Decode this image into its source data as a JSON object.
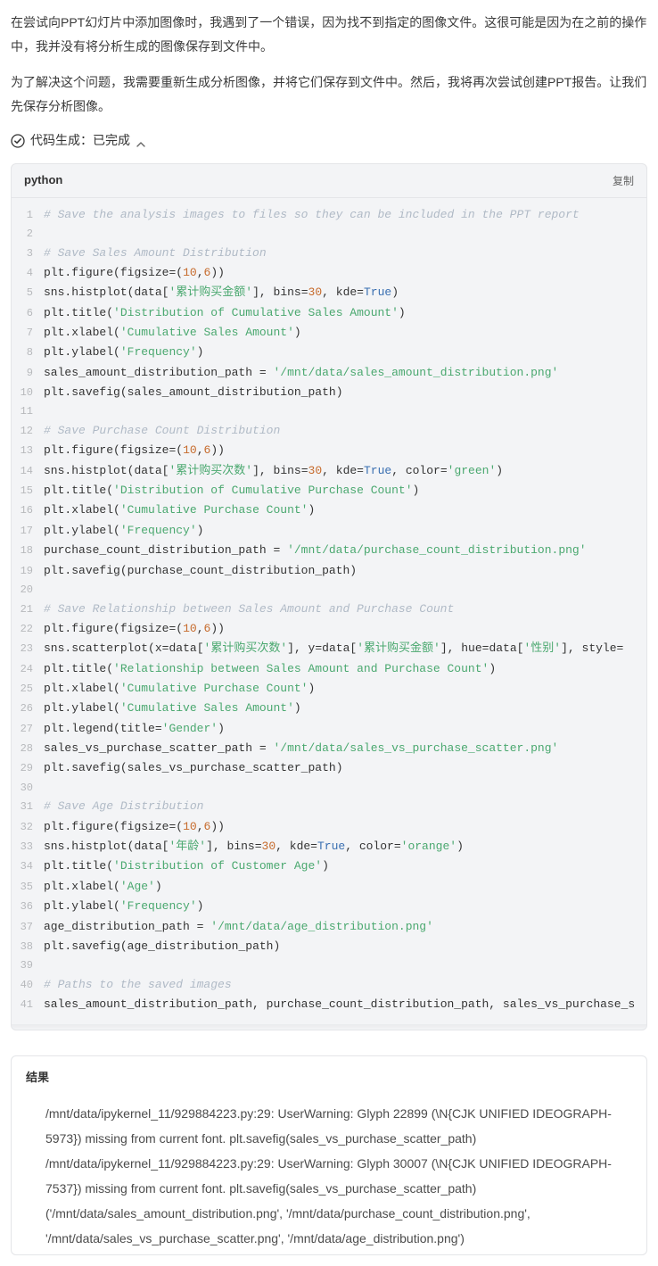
{
  "intro": {
    "p1": "在尝试向PPT幻灯片中添加图像时，我遇到了一个错误，因为找不到指定的图像文件。这很可能是因为在之前的操作中，我并没有将分析生成的图像保存到文件中。",
    "p2": "为了解决这个问题，我需要重新生成分析图像，并将它们保存到文件中。然后，我将再次尝试创建PPT报告。让我们先保存分析图像。"
  },
  "status": {
    "label": "代码生成：已完成"
  },
  "code": {
    "language": "python",
    "copy_label": "复制",
    "lines": [
      {
        "n": 1,
        "t": "comment",
        "text": "# Save the analysis images to files so they can be included in the PPT report"
      },
      {
        "n": 2,
        "t": "blank",
        "text": ""
      },
      {
        "n": 3,
        "t": "comment",
        "text": "# Save Sales Amount Distribution"
      },
      {
        "n": 4,
        "t": "code",
        "seg": [
          "plt",
          ".",
          "figure",
          "(",
          "figsize",
          "=",
          "(",
          {
            "num": "10"
          },
          ",",
          {
            "num": "6"
          },
          ")",
          ")"
        ]
      },
      {
        "n": 5,
        "t": "code",
        "seg": [
          "sns",
          ".",
          "histplot",
          "(",
          "data",
          "[",
          {
            "str": "'累计购买金额'"
          },
          "]",
          ", ",
          "bins",
          "=",
          {
            "num": "30"
          },
          ", ",
          "kde",
          "=",
          {
            "kw": "True"
          },
          ")"
        ]
      },
      {
        "n": 6,
        "t": "code",
        "seg": [
          "plt",
          ".",
          "title",
          "(",
          {
            "str": "'Distribution of Cumulative Sales Amount'"
          },
          ")"
        ]
      },
      {
        "n": 7,
        "t": "code",
        "seg": [
          "plt",
          ".",
          "xlabel",
          "(",
          {
            "str": "'Cumulative Sales Amount'"
          },
          ")"
        ]
      },
      {
        "n": 8,
        "t": "code",
        "seg": [
          "plt",
          ".",
          "ylabel",
          "(",
          {
            "str": "'Frequency'"
          },
          ")"
        ]
      },
      {
        "n": 9,
        "t": "code",
        "seg": [
          "sales_amount_distribution_path",
          " ",
          "=",
          " ",
          {
            "str": "'/mnt/data/sales_amount_distribution.png'"
          }
        ]
      },
      {
        "n": 10,
        "t": "code",
        "seg": [
          "plt",
          ".",
          "savefig",
          "(",
          "sales_amount_distribution_path",
          ")"
        ]
      },
      {
        "n": 11,
        "t": "blank",
        "text": ""
      },
      {
        "n": 12,
        "t": "comment",
        "text": "# Save Purchase Count Distribution"
      },
      {
        "n": 13,
        "t": "code",
        "seg": [
          "plt",
          ".",
          "figure",
          "(",
          "figsize",
          "=",
          "(",
          {
            "num": "10"
          },
          ",",
          {
            "num": "6"
          },
          ")",
          ")"
        ]
      },
      {
        "n": 14,
        "t": "code",
        "seg": [
          "sns",
          ".",
          "histplot",
          "(",
          "data",
          "[",
          {
            "str": "'累计购买次数'"
          },
          "]",
          ", ",
          "bins",
          "=",
          {
            "num": "30"
          },
          ", ",
          "kde",
          "=",
          {
            "kw": "True"
          },
          ", ",
          "color",
          "=",
          {
            "str": "'green'"
          },
          ")"
        ]
      },
      {
        "n": 15,
        "t": "code",
        "seg": [
          "plt",
          ".",
          "title",
          "(",
          {
            "str": "'Distribution of Cumulative Purchase Count'"
          },
          ")"
        ]
      },
      {
        "n": 16,
        "t": "code",
        "seg": [
          "plt",
          ".",
          "xlabel",
          "(",
          {
            "str": "'Cumulative Purchase Count'"
          },
          ")"
        ]
      },
      {
        "n": 17,
        "t": "code",
        "seg": [
          "plt",
          ".",
          "ylabel",
          "(",
          {
            "str": "'Frequency'"
          },
          ")"
        ]
      },
      {
        "n": 18,
        "t": "code",
        "seg": [
          "purchase_count_distribution_path",
          " ",
          "=",
          " ",
          {
            "str": "'/mnt/data/purchase_count_distribution.png'"
          }
        ]
      },
      {
        "n": 19,
        "t": "code",
        "seg": [
          "plt",
          ".",
          "savefig",
          "(",
          "purchase_count_distribution_path",
          ")"
        ]
      },
      {
        "n": 20,
        "t": "blank",
        "text": ""
      },
      {
        "n": 21,
        "t": "comment",
        "text": "# Save Relationship between Sales Amount and Purchase Count"
      },
      {
        "n": 22,
        "t": "code",
        "seg": [
          "plt",
          ".",
          "figure",
          "(",
          "figsize",
          "=",
          "(",
          {
            "num": "10"
          },
          ",",
          {
            "num": "6"
          },
          ")",
          ")"
        ]
      },
      {
        "n": 23,
        "t": "code",
        "seg": [
          "sns",
          ".",
          "scatterplot",
          "(",
          "x",
          "=",
          "data",
          "[",
          {
            "str": "'累计购买次数'"
          },
          "]",
          ", ",
          "y",
          "=",
          "data",
          "[",
          {
            "str": "'累计购买金额'"
          },
          "]",
          ", ",
          "hue",
          "=",
          "data",
          "[",
          {
            "str": "'性别'"
          },
          "]",
          ", ",
          "style",
          "="
        ]
      },
      {
        "n": 24,
        "t": "code",
        "seg": [
          "plt",
          ".",
          "title",
          "(",
          {
            "str": "'Relationship between Sales Amount and Purchase Count'"
          },
          ")"
        ]
      },
      {
        "n": 25,
        "t": "code",
        "seg": [
          "plt",
          ".",
          "xlabel",
          "(",
          {
            "str": "'Cumulative Purchase Count'"
          },
          ")"
        ]
      },
      {
        "n": 26,
        "t": "code",
        "seg": [
          "plt",
          ".",
          "ylabel",
          "(",
          {
            "str": "'Cumulative Sales Amount'"
          },
          ")"
        ]
      },
      {
        "n": 27,
        "t": "code",
        "seg": [
          "plt",
          ".",
          "legend",
          "(",
          "title",
          "=",
          {
            "str": "'Gender'"
          },
          ")"
        ]
      },
      {
        "n": 28,
        "t": "code",
        "seg": [
          "sales_vs_purchase_scatter_path",
          " ",
          "=",
          " ",
          {
            "str": "'/mnt/data/sales_vs_purchase_scatter.png'"
          }
        ]
      },
      {
        "n": 29,
        "t": "code",
        "seg": [
          "plt",
          ".",
          "savefig",
          "(",
          "sales_vs_purchase_scatter_path",
          ")"
        ]
      },
      {
        "n": 30,
        "t": "blank",
        "text": ""
      },
      {
        "n": 31,
        "t": "comment",
        "text": "# Save Age Distribution"
      },
      {
        "n": 32,
        "t": "code",
        "seg": [
          "plt",
          ".",
          "figure",
          "(",
          "figsize",
          "=",
          "(",
          {
            "num": "10"
          },
          ",",
          {
            "num": "6"
          },
          ")",
          ")"
        ]
      },
      {
        "n": 33,
        "t": "code",
        "seg": [
          "sns",
          ".",
          "histplot",
          "(",
          "data",
          "[",
          {
            "str": "'年龄'"
          },
          "]",
          ", ",
          "bins",
          "=",
          {
            "num": "30"
          },
          ", ",
          "kde",
          "=",
          {
            "kw": "True"
          },
          ", ",
          "color",
          "=",
          {
            "str": "'orange'"
          },
          ")"
        ]
      },
      {
        "n": 34,
        "t": "code",
        "seg": [
          "plt",
          ".",
          "title",
          "(",
          {
            "str": "'Distribution of Customer Age'"
          },
          ")"
        ]
      },
      {
        "n": 35,
        "t": "code",
        "seg": [
          "plt",
          ".",
          "xlabel",
          "(",
          {
            "str": "'Age'"
          },
          ")"
        ]
      },
      {
        "n": 36,
        "t": "code",
        "seg": [
          "plt",
          ".",
          "ylabel",
          "(",
          {
            "str": "'Frequency'"
          },
          ")"
        ]
      },
      {
        "n": 37,
        "t": "code",
        "seg": [
          "age_distribution_path",
          " ",
          "=",
          " ",
          {
            "str": "'/mnt/data/age_distribution.png'"
          }
        ]
      },
      {
        "n": 38,
        "t": "code",
        "seg": [
          "plt",
          ".",
          "savefig",
          "(",
          "age_distribution_path",
          ")"
        ]
      },
      {
        "n": 39,
        "t": "blank",
        "text": ""
      },
      {
        "n": 40,
        "t": "comment",
        "text": "# Paths to the saved images"
      },
      {
        "n": 41,
        "t": "code",
        "seg": [
          "sales_amount_distribution_path",
          ", ",
          "purchase_count_distribution_path",
          ", ",
          "sales_vs_purchase_s"
        ]
      }
    ]
  },
  "result": {
    "title": "结果",
    "body": "/mnt/data/ipykernel_11/929884223.py:29: UserWarning: Glyph 22899 (\\N{CJK UNIFIED IDEOGRAPH-5973}) missing from current font. plt.savefig(sales_vs_purchase_scatter_path)\n/mnt/data/ipykernel_11/929884223.py:29: UserWarning: Glyph 30007 (\\N{CJK UNIFIED IDEOGRAPH-7537}) missing from current font. plt.savefig(sales_vs_purchase_scatter_path)\n('/mnt/data/sales_amount_distribution.png', '/mnt/data/purchase_count_distribution.png', '/mnt/data/sales_vs_purchase_scatter.png', '/mnt/data/age_distribution.png')"
  }
}
